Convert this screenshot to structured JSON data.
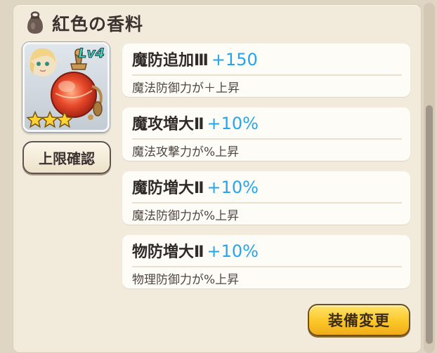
{
  "panel": {
    "title": "紅色の香料",
    "title_icon": "pouch-icon"
  },
  "item": {
    "level": "Lv4",
    "stars": 3,
    "icon": "red-perfume-bottle-icon",
    "limit_button": "上限確認"
  },
  "stats": [
    {
      "name": "魔防追加Ⅲ",
      "value": "+150",
      "desc": "魔法防御力が＋上昇"
    },
    {
      "name": "魔攻増大Ⅱ",
      "value": "+10%",
      "desc": "魔法攻撃力が%上昇"
    },
    {
      "name": "魔防増大Ⅱ",
      "value": "+10%",
      "desc": "魔法防御力が%上昇"
    },
    {
      "name": "物防増大Ⅱ",
      "value": "+10%",
      "desc": "物理防御力が%上昇"
    }
  ],
  "equip_button": "装備変更",
  "colors": {
    "value_blue": "#23a6ee",
    "button_gold": "#fbc728",
    "panel_bg": "#f2ebdc"
  }
}
